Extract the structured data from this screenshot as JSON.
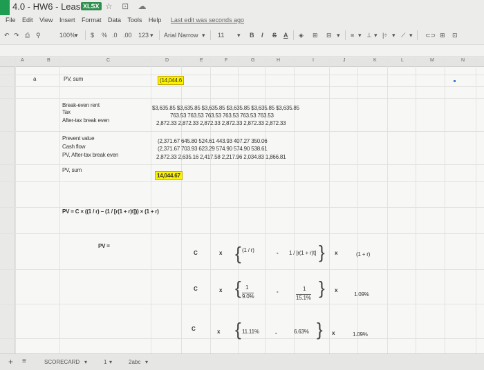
{
  "header": {
    "title": "4.0 - HW6 - Leases",
    "badge": "XLSX",
    "title_icons": "☆ ⊡ ☁"
  },
  "menu": {
    "items": [
      "File",
      "Edit",
      "View",
      "Insert",
      "Format",
      "Data",
      "Tools",
      "Help"
    ],
    "last_edit": "Last edit was seconds ago"
  },
  "toolbar": {
    "undo": "↶",
    "redo": "↷",
    "print": "⎙",
    "paint": "⚲",
    "zoom": "100%",
    "currency": "$",
    "percent": "%",
    "dec_less": ".0",
    "dec_more": ".00",
    "format_more": "123",
    "font": "Arial Narrow",
    "font_size": "11",
    "bold": "B",
    "italic": "I",
    "strike": "S",
    "text_color": "A",
    "fill": "◈",
    "borders": "⊞",
    "merge": "⊟",
    "align": "≡",
    "valign": "⊥",
    "wrap": "|÷",
    "rotate": "⟋",
    "link": "⊂⊃",
    "comment": "⊞",
    "chart": "⊡"
  },
  "columns": [
    "A",
    "B",
    "C",
    "D",
    "E",
    "F",
    "G",
    "H",
    "I",
    "J",
    "K",
    "L",
    "M",
    "N"
  ],
  "row_label": "a",
  "sheet": {
    "pv_sum_label_1": "PV, sum",
    "pv_sum_value_1": "(14,044.6",
    "breakeven_label": "Break-even rent",
    "tax_label": "Tax",
    "aftertax_label": "After-tax break even",
    "breakeven_row": "$3,635.85  $3,635.85  $3,635.85  $3,635.85  $3,635.85  $3,635.85",
    "tax_row": "763.53     763.53     763.53     763.53     763.53     763.53",
    "aftertax_row": "2,872.33  2,872.33  2,872.33  2,872.33  2,872.33  2,872.33",
    "prevent_label": "Prevent value",
    "cashflow_label": "Cash flow",
    "pv_aftertax_label": "PV, After-tax break even",
    "prevent_row": "(2,371.67    645.80     524.61     443.93     407.27     350.06",
    "cashflow_row": "(2,371.67    703.93     623.29     574.90     574.90     538.61",
    "pv_aftertax_row": "2,872.33  2,635.16  2,417.58  2,217.96  2,034.83  1,866.81",
    "pv_sum_label_2": "PV, sum",
    "pv_sum_value_2": "14,044.67",
    "formula": "PV = C × ((1 / r) − (1 / [r(1 + r)t])) × (1 + r)",
    "pv_eq": "PV =",
    "c": "C",
    "x": "x",
    "dash": "-",
    "frac_1r": "(1 / r)",
    "frac_big": "1 / [r(1 + r)t]",
    "one_plus_r": "(1 + r)",
    "one": "1",
    "r_val": "9.0%",
    "den_val": "15.1%",
    "mult": "1.09%",
    "inv_r": "11.11%",
    "mid_val": "6.63%"
  },
  "tabs": {
    "add": "+",
    "list": "≡",
    "sheet1": "SCORECARD",
    "sheet2": "1",
    "sheet3": "2abc"
  }
}
